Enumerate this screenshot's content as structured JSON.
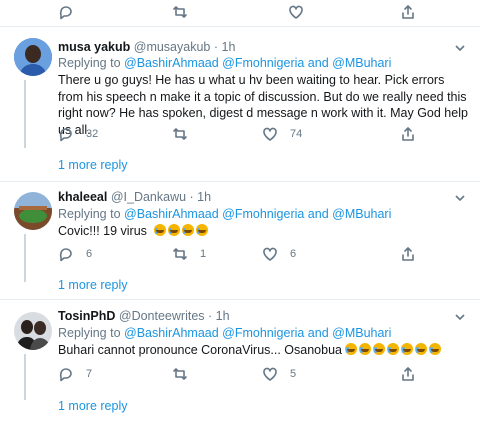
{
  "top_actions": {
    "retweet_count": "",
    "like_count": ""
  },
  "tweets": [
    {
      "name": "musa yakub",
      "handle": "@musayakub",
      "time": "· 1h",
      "replying_prefix": "Replying to ",
      "replying_to": "@BashirAhmaad @Fmohnigeria and @MBuhari",
      "text": "There u go guys!  He has u what u hv been waiting to hear. Pick errors from his speech n make it a topic of discussion. But do we really need this right now? He has spoken, digest d message n work with it. May God help us all.",
      "reply_count": "32",
      "retweet_count": "",
      "like_count": "74",
      "more_replies": "1 more reply"
    },
    {
      "name": "khaleeal",
      "handle": "@I_Dankawu",
      "time": "· 1h",
      "replying_prefix": "Replying to ",
      "replying_to": "@BashirAhmaad @Fmohnigeria and @MBuhari",
      "text": "Covic!!! 19 virus",
      "emoji_count": 4,
      "reply_count": "6",
      "retweet_count": "1",
      "like_count": "6",
      "more_replies": "1 more reply"
    },
    {
      "name": "TosinPhD",
      "handle": "@Donteewrites",
      "time": "· 1h",
      "replying_prefix": "Replying to ",
      "replying_to": "@BashirAhmaad @Fmohnigeria and @MBuhari",
      "text": "Buhari cannot pronounce CoronaVirus... Osanobua",
      "emoji_count": 7,
      "reply_count": "7",
      "retweet_count": "",
      "like_count": "5",
      "more_replies": "1 more reply"
    }
  ],
  "colors": {
    "link": "#1b95e0",
    "muted": "#657786",
    "divider": "#e6ecf0"
  }
}
